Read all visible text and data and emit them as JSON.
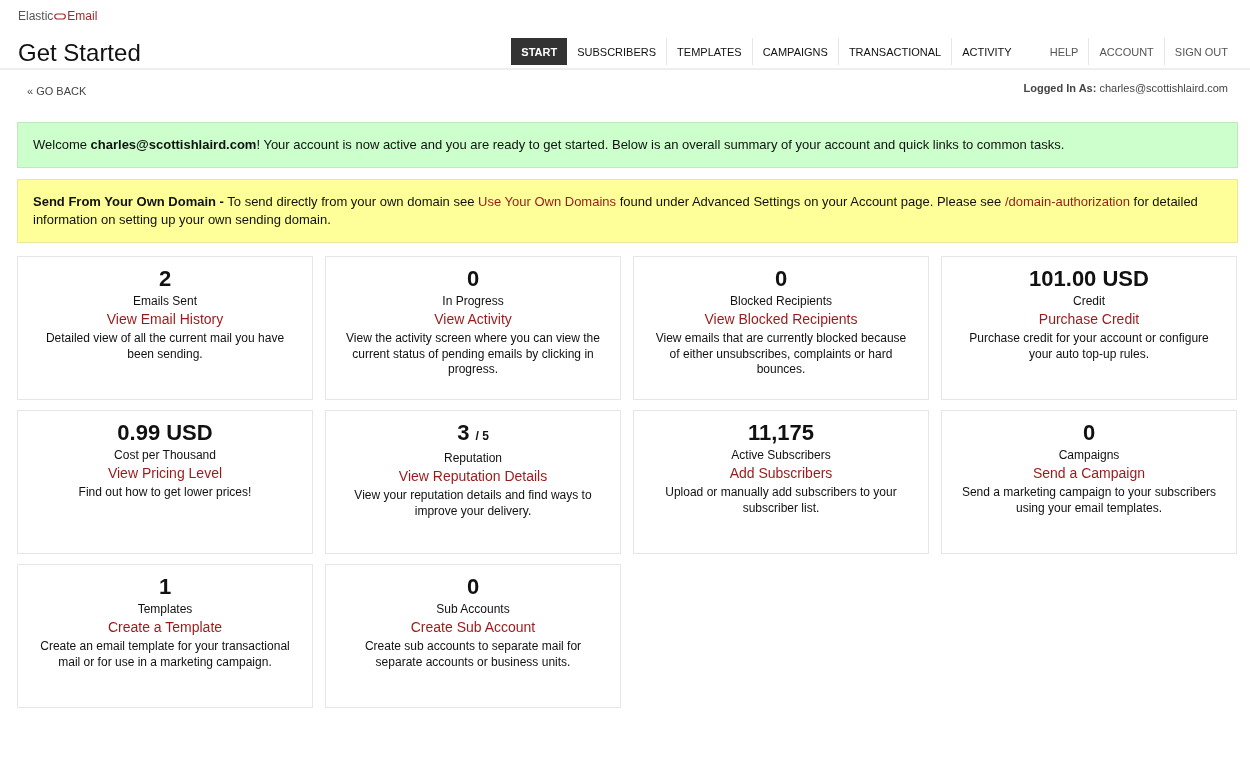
{
  "logo": {
    "part_1": "Elastic",
    "part_2": "Email"
  },
  "page_title": "Get Started",
  "nav": [
    {
      "label": "START",
      "selected": true
    },
    {
      "label": "SUBSCRIBERS",
      "selected": false
    },
    {
      "label": "TEMPLATES",
      "selected": false
    },
    {
      "label": "CAMPAIGNS",
      "selected": false
    },
    {
      "label": "TRANSACTIONAL",
      "selected": false
    },
    {
      "label": "ACTIVITY",
      "selected": false
    }
  ],
  "user_nav": [
    "HELP",
    "ACCOUNT",
    "SIGN OUT"
  ],
  "go_back": "« GO BACK",
  "logged_in": {
    "label": "Logged In As:",
    "email": "charles@scottishlaird.com"
  },
  "welcome": "Welcome **charles@scottishlaird.com**! Your account is now active and you are ready to get started. Below is an overall summary of your account and quick links to common tasks.",
  "domain_notice": [
    {
      "kind": "text",
      "text": "**Send From Your Own Domain -** To send directly from your own domain see "
    },
    {
      "kind": "link",
      "text": "Use Your Own Domains"
    },
    {
      "kind": "text",
      "text": " found under Advanced Settings on your Account page. Please see "
    },
    {
      "kind": "link",
      "text": "/domain-authorization"
    },
    {
      "kind": "text",
      "text": " for detailed information on setting up your own sending domain."
    }
  ],
  "cards": [
    {
      "value": "2",
      "label": "Emails Sent",
      "link": "View Email History",
      "description": "Detailed view of all the current mail you have been sending."
    },
    {
      "value": "0",
      "label": "In Progress",
      "link": "View Activity",
      "description": "View the activity screen where you can view the current status of pending emails by clicking in progress."
    },
    {
      "value": "0",
      "label": "Blocked Recipients",
      "link": "View Blocked Recipients",
      "description": "View emails that are currently blocked because of either unsubscribes, complaints or hard bounces."
    },
    {
      "value": "101.00 USD",
      "label": "Credit",
      "link": "Purchase Credit",
      "description": "Purchase credit for your account or configure your auto top-up rules."
    },
    {
      "value": "0.99 USD",
      "label": "Cost per Thousand",
      "link": "View Pricing Level",
      "description": "Find out how to get lower prices!"
    },
    {
      "value": "3",
      "suffix": "/ 5",
      "label": "Reputation",
      "link": "View Reputation Details",
      "description": "View your reputation details and find ways to improve your delivery."
    },
    {
      "value": "11,175",
      "label": "Active Subscribers",
      "link": "Add Subscribers",
      "description": "Upload or manually add subscribers to your subscriber list."
    },
    {
      "value": "0",
      "label": "Campaigns",
      "link": "Send a Campaign",
      "description": "Send a marketing campaign to your subscribers using your email templates."
    },
    {
      "value": "1",
      "label": "Templates",
      "link": "Create a Template",
      "description": "Create an email template for your transactional mail or for use in a marketing campaign."
    },
    {
      "value": "0",
      "label": "Sub Accounts",
      "link": "Create Sub Account",
      "description": "Create sub accounts to separate mail for separate accounts or business units."
    }
  ]
}
